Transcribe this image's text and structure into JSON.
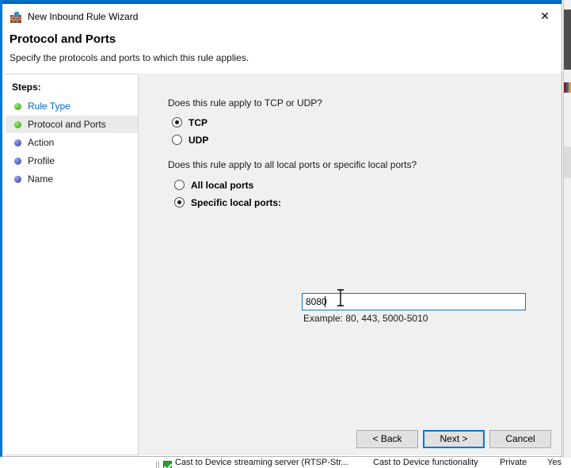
{
  "window": {
    "title": "New Inbound Rule Wizard",
    "icon": "firewall-globe-icon",
    "close_label": "✕",
    "accent_color": "#0078d7"
  },
  "header": {
    "title": "Protocol and Ports",
    "subtitle": "Specify the protocols and ports to which this rule applies."
  },
  "sidebar": {
    "label": "Steps:",
    "items": [
      {
        "label": "Rule Type",
        "state": "done",
        "is_link": true
      },
      {
        "label": "Protocol and Ports",
        "state": "done",
        "is_link": false
      },
      {
        "label": "Action",
        "state": "todo",
        "is_link": false
      },
      {
        "label": "Profile",
        "state": "todo",
        "is_link": false
      },
      {
        "label": "Name",
        "state": "todo",
        "is_link": false
      }
    ]
  },
  "content": {
    "protocol_question": "Does this rule apply to TCP or UDP?",
    "protocol_options": [
      {
        "label": "TCP",
        "checked": true
      },
      {
        "label": "UDP",
        "checked": false
      }
    ],
    "ports_question": "Does this rule apply to all local ports or specific local ports?",
    "ports_options": [
      {
        "label": "All local ports",
        "checked": false
      },
      {
        "label": "Specific local ports:",
        "checked": true
      }
    ],
    "port_input_value": "8080",
    "port_input_placeholder": "",
    "example_text": "Example: 80, 443, 5000-5010"
  },
  "footer": {
    "back_label": "< Back",
    "next_label": "Next >",
    "cancel_label": "Cancel"
  },
  "background": {
    "row": {
      "name": "Cast to Device streaming server (RTSP-Str...",
      "group": "Cast to Device functionality",
      "profile": "Private",
      "enabled": "Yes"
    }
  }
}
